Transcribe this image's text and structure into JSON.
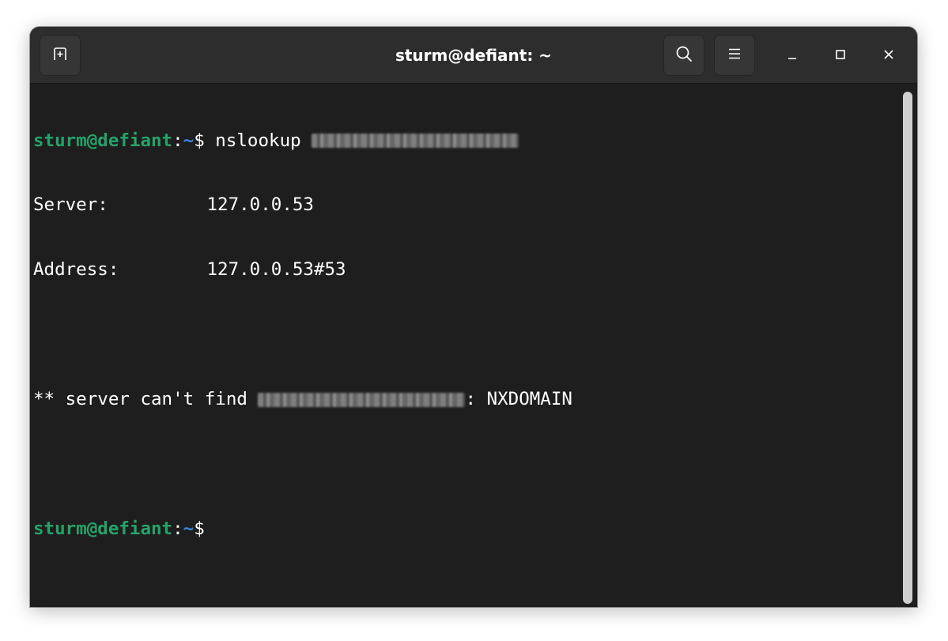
{
  "window": {
    "title": "sturm@defiant: ~"
  },
  "icons": {
    "new_tab": "new-tab-icon",
    "search": "search-icon",
    "menu": "hamburger-menu-icon",
    "minimize": "minimize-icon",
    "maximize": "maximize-icon",
    "close": "close-icon"
  },
  "colors": {
    "prompt_user": "#26a269",
    "prompt_path": "#3584e4",
    "terminal_bg": "#1e1e1e",
    "titlebar_bg": "#2d2d2d",
    "text": "#ffffff"
  },
  "terminal": {
    "prompt_user_host": "sturm@defiant",
    "prompt_colon": ":",
    "prompt_path": "~",
    "prompt_dollar": "$",
    "command": " nslookup ",
    "server_label": "Server:",
    "server_value": "127.0.0.53",
    "address_label": "Address:",
    "address_value": "127.0.0.53#53",
    "error_prefix": "** server can't find ",
    "error_suffix": ": NXDOMAIN"
  }
}
